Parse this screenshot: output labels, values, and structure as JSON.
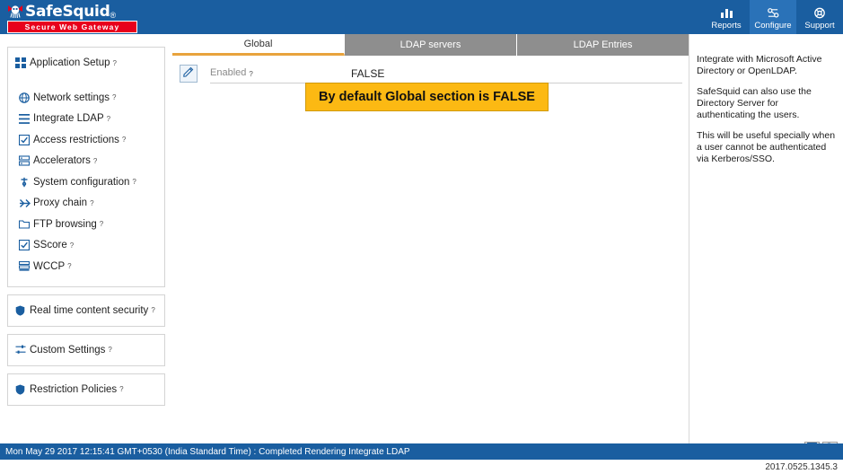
{
  "header": {
    "brand_name": "SafeSquid",
    "brand_reg": "®",
    "brand_tagline": "Secure Web Gateway",
    "nav": [
      {
        "label": "Reports",
        "icon": "reports-icon",
        "active": false
      },
      {
        "label": "Configure",
        "icon": "gear-icon",
        "active": true
      },
      {
        "label": "Support",
        "icon": "lifebuoy-icon",
        "active": false
      }
    ]
  },
  "sidebar": {
    "groups": [
      {
        "head": {
          "label": "Application Setup",
          "icon": "grid-icon",
          "help": "?"
        },
        "items": [
          {
            "label": "Network settings",
            "icon": "globe-icon",
            "help": "?"
          },
          {
            "label": "Integrate LDAP",
            "icon": "list-icon",
            "help": "?",
            "selected": true
          },
          {
            "label": "Access restrictions",
            "icon": "check-square-icon",
            "help": "?"
          },
          {
            "label": "Accelerators",
            "icon": "server-icon",
            "help": "?"
          },
          {
            "label": "System configuration",
            "icon": "wrench-icon",
            "help": "?"
          },
          {
            "label": "Proxy chain",
            "icon": "link-icon",
            "help": "?"
          },
          {
            "label": "FTP browsing",
            "icon": "folder-icon",
            "help": "?"
          },
          {
            "label": "SScore",
            "icon": "check-square-icon",
            "help": "?"
          },
          {
            "label": "WCCP",
            "icon": "stack-icon",
            "help": "?"
          }
        ]
      },
      {
        "head": {
          "label": "Real time content security",
          "icon": "shield-icon",
          "help": "?"
        },
        "items": []
      },
      {
        "head": {
          "label": "Custom Settings",
          "icon": "sliders-icon",
          "help": "?"
        },
        "items": []
      },
      {
        "head": {
          "label": "Restriction Policies",
          "icon": "badge-icon",
          "help": "?"
        },
        "items": []
      }
    ]
  },
  "tabs": [
    {
      "label": "Global",
      "active": true
    },
    {
      "label": "LDAP servers",
      "active": false
    },
    {
      "label": "LDAP Entries",
      "active": false
    }
  ],
  "main": {
    "edit_icon": "edit-icon",
    "field_label": "Enabled",
    "field_help": "?",
    "field_value": "FALSE",
    "callout": "By default Global section is FALSE"
  },
  "help": {
    "paragraphs": [
      "Integrate with Microsoft Active Directory or OpenLDAP.",
      "SafeSquid can also use the Directory Server for authenticating the users.",
      "This will be useful specially when a user cannot be authenticated via Kerberos/SSO."
    ]
  },
  "status": {
    "message": "Mon May 29 2017 12:15:41 GMT+0530 (India Standard Time) : Completed Rendering Integrate LDAP",
    "buttons": [
      {
        "name": "save-icon",
        "glyph": "ὋE"
      },
      {
        "name": "search-icon",
        "glyph": "⚲"
      }
    ],
    "version": "2017.0525.1345.3"
  },
  "colors": {
    "header_blue": "#1a5ea0",
    "nav_active": "#2a72b8",
    "accent_orange": "#e8a33d",
    "callout_bg": "#fcb913",
    "brand_red": "#e8001c"
  }
}
